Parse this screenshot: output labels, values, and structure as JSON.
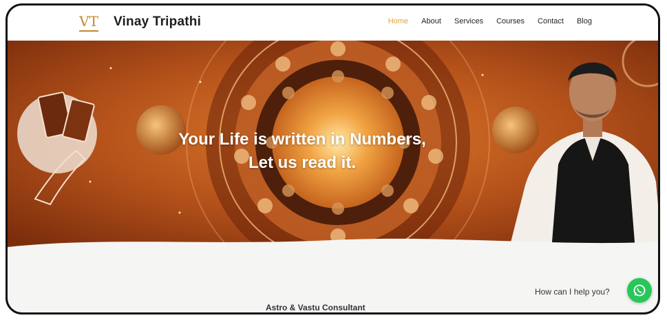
{
  "brand": {
    "name": "Vinay Tripathi",
    "logo_text": "VT"
  },
  "nav": {
    "items": [
      "Home",
      "About",
      "Services",
      "Courses",
      "Contact",
      "Blog"
    ],
    "active": "Home"
  },
  "hero": {
    "line1": "Your Life is written in Numbers,",
    "line2": "Let us read it."
  },
  "chat": {
    "prompt": "How can I help you?",
    "icon": "whatsapp-icon"
  },
  "section": {
    "heading": "Astro & Vastu Consultant"
  },
  "colors": {
    "accent": "#e2a23b",
    "hero_bg": "#9a3e12",
    "whatsapp": "#27c75a"
  }
}
